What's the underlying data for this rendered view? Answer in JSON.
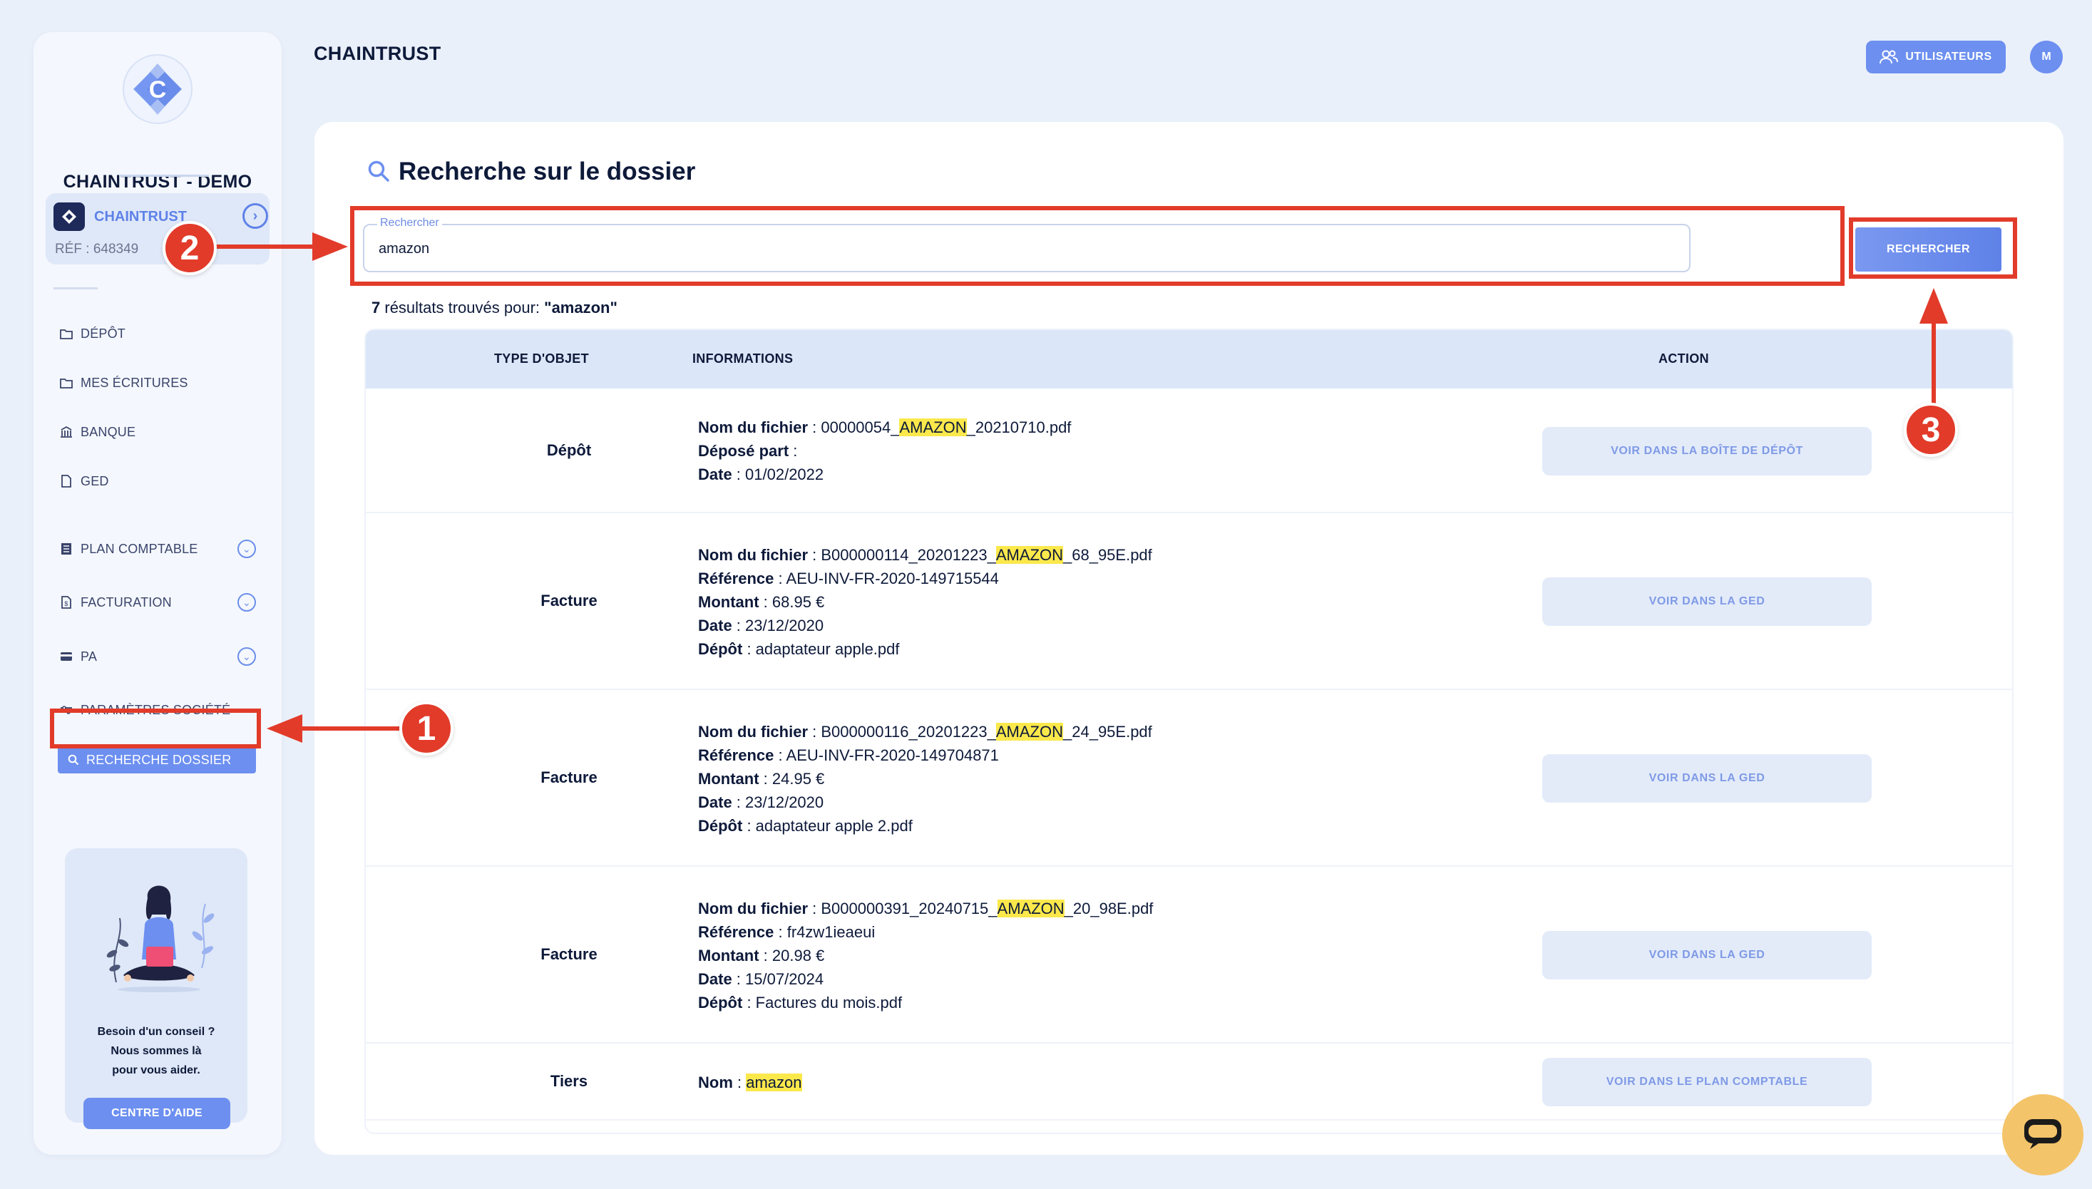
{
  "header": {
    "app_title": "CHAINTRUST",
    "users_button": "UTILISATEURS",
    "avatar_initial": "M"
  },
  "sidebar": {
    "company_name": "CHAINTRUST - DEMO",
    "org": {
      "name": "CHAINTRUST",
      "ref": "RÉF : 648349"
    },
    "items": [
      {
        "label": "DÉPÔT",
        "icon": "folder-icon"
      },
      {
        "label": "MES ÉCRITURES",
        "icon": "folder-icon"
      },
      {
        "label": "BANQUE",
        "icon": "bank-icon"
      },
      {
        "label": "GED",
        "icon": "document-icon"
      },
      {
        "label": "PLAN COMPTABLE",
        "icon": "ledger-icon"
      },
      {
        "label": "FACTURATION",
        "icon": "invoice-icon"
      },
      {
        "label": "PA",
        "icon": "card-icon"
      },
      {
        "label": "PARAMÈTRES SOCIÉTÉ",
        "icon": "sliders-icon"
      },
      {
        "label": "RECHERCHE DOSSIER",
        "icon": "search-icon"
      }
    ],
    "help": {
      "line1": "Besoin d'un conseil ?",
      "line2": "Nous sommes là",
      "line3": "pour vous aider.",
      "button": "CENTRE D'AIDE"
    }
  },
  "main": {
    "title": "Recherche sur le dossier",
    "search": {
      "legend": "Rechercher",
      "value": "amazon",
      "button": "RECHERCHER"
    },
    "results": {
      "count": "7",
      "text": " résultats trouvés pour: ",
      "query": "\"amazon\""
    },
    "table": {
      "headers": [
        "TYPE D'OBJET",
        "INFORMATIONS",
        "ACTION"
      ],
      "rows": [
        {
          "type": "Dépôt",
          "lines": [
            {
              "label": "Nom du fichier",
              "pre": "00000054_",
              "hl": "AMAZON",
              "post": "_20210710.pdf"
            },
            {
              "label": "Déposé part",
              "value": ""
            },
            {
              "label": "Date",
              "value": "01/02/2022"
            }
          ],
          "action": "VOIR DANS LA BOÎTE DE DÉPÔT"
        },
        {
          "type": "Facture",
          "lines": [
            {
              "label": "Nom du fichier",
              "pre": "B000000114_20201223_",
              "hl": "AMAZON",
              "post": "_68_95E.pdf"
            },
            {
              "label": "Référence",
              "value": "AEU-INV-FR-2020-149715544"
            },
            {
              "label": "Montant",
              "value": "68.95 €"
            },
            {
              "label": "Date",
              "value": "23/12/2020"
            },
            {
              "label": "Dépôt",
              "value": "adaptateur apple.pdf"
            }
          ],
          "action": "VOIR DANS LA GED"
        },
        {
          "type": "Facture",
          "lines": [
            {
              "label": "Nom du fichier",
              "pre": "B000000116_20201223_",
              "hl": "AMAZON",
              "post": "_24_95E.pdf"
            },
            {
              "label": "Référence",
              "value": "AEU-INV-FR-2020-149704871"
            },
            {
              "label": "Montant",
              "value": "24.95 €"
            },
            {
              "label": "Date",
              "value": "23/12/2020"
            },
            {
              "label": "Dépôt",
              "value": "adaptateur apple 2.pdf"
            }
          ],
          "action": "VOIR DANS LA GED"
        },
        {
          "type": "Facture",
          "lines": [
            {
              "label": "Nom du fichier",
              "pre": "B000000391_20240715_",
              "hl": "AMAZON",
              "post": "_20_98E.pdf"
            },
            {
              "label": "Référence",
              "value": "fr4zw1ieaeui"
            },
            {
              "label": "Montant",
              "value": "20.98 €"
            },
            {
              "label": "Date",
              "value": "15/07/2024"
            },
            {
              "label": "Dépôt",
              "value": "Factures du mois.pdf"
            }
          ],
          "action": "VOIR DANS LA GED"
        },
        {
          "type": "Tiers",
          "lines": [
            {
              "label": "Nom",
              "pre": "",
              "hl": "amazon",
              "post": ""
            }
          ],
          "action": "VOIR DANS LE PLAN COMPTABLE"
        }
      ]
    }
  },
  "annotations": {
    "step1": "1",
    "step2": "2",
    "step3": "3",
    "color": "#e23b2a"
  },
  "colors": {
    "accent": "#6c8ff0",
    "background": "#eaf0fa",
    "highlight": "#fbe84b",
    "chat_button": "#f4c46a"
  }
}
